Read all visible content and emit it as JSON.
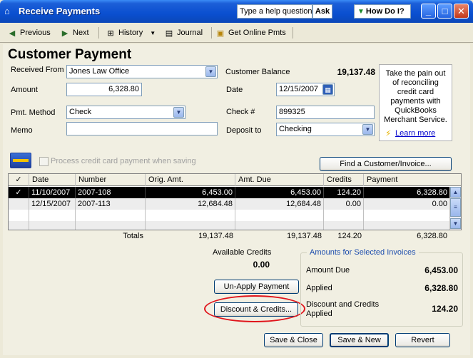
{
  "window": {
    "title": "Receive Payments",
    "help_placeholder": "Type a help question",
    "ask_label": "Ask",
    "howdoi_label": "How Do I?",
    "minimize": "_",
    "maximize": "□",
    "close": "✕"
  },
  "toolbar": {
    "previous": "Previous",
    "next": "Next",
    "history": "History",
    "journal": "Journal",
    "get_online_pmts": "Get Online Pmts"
  },
  "form": {
    "heading": "Customer Payment",
    "received_from_label": "Received From",
    "received_from_value": "Jones Law Office",
    "customer_balance_label": "Customer Balance",
    "customer_balance_value": "19,137.48",
    "amount_label": "Amount",
    "amount_value": "6,328.80",
    "date_label": "Date",
    "date_value": "12/15/2007",
    "pmt_method_label": "Pmt. Method",
    "pmt_method_value": "Check",
    "check_no_label": "Check #",
    "check_no_value": "899325",
    "memo_label": "Memo",
    "memo_value": "",
    "deposit_to_label": "Deposit to",
    "deposit_to_value": "Checking",
    "process_cc_label": "Process credit card payment when saving",
    "find_button": "Find a Customer/Invoice..."
  },
  "ad": {
    "text": "Take the pain out of reconciling credit card payments with QuickBooks Merchant Service.",
    "link": "Learn more"
  },
  "table": {
    "headers": [
      "✓",
      "Date",
      "Number",
      "Orig. Amt.",
      "Amt. Due",
      "Credits",
      "Payment"
    ],
    "rows": [
      {
        "check": "✓",
        "date": "11/10/2007",
        "number": "2007-108",
        "orig": "6,453.00",
        "due": "6,453.00",
        "credits": "124.20",
        "payment": "6,328.80"
      },
      {
        "check": "",
        "date": "12/15/2007",
        "number": "2007-113",
        "orig": "12,684.48",
        "due": "12,684.48",
        "credits": "0.00",
        "payment": "0.00"
      }
    ],
    "totals": {
      "label": "Totals",
      "orig": "19,137.48",
      "due": "19,137.48",
      "credits": "124.20",
      "payment": "6,328.80"
    }
  },
  "summary": {
    "available_credits_label": "Available Credits",
    "available_credits_value": "0.00",
    "unapply_button": "Un-Apply Payment",
    "discount_button": "Discount & Credits...",
    "amounts_title": "Amounts for Selected Invoices",
    "amount_due_label": "Amount Due",
    "amount_due_value": "6,453.00",
    "applied_label": "Applied",
    "applied_value": "6,328.80",
    "disc_credits_label_1": "Discount and Credits",
    "disc_credits_label_2": "Applied",
    "disc_credits_value": "124.20"
  },
  "actions": {
    "save_close": "Save & Close",
    "save_new": "Save & New",
    "revert": "Revert"
  },
  "colors": {
    "titlebar": "#0a4fd0",
    "selected_row": "#000000",
    "highlight_ellipse": "#e0141b",
    "amounts_title": "#1f4fae"
  }
}
